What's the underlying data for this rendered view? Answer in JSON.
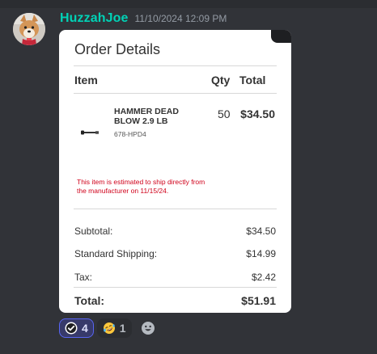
{
  "message": {
    "username": "HuzzahJoe",
    "timestamp": "11/10/2024 12:09 PM",
    "username_color": "#00d2b6"
  },
  "order": {
    "title": "Order Details",
    "headers": {
      "item": "Item",
      "qty": "Qty",
      "total": "Total"
    },
    "item": {
      "name": "HAMMER DEAD BLOW 2.9 LB",
      "sku": "678-HPD4",
      "qty": "50",
      "price": "$34.50"
    },
    "shipping_note": "This item is estimated to ship directly from the manufacturer on 11/15/24.",
    "summary": [
      {
        "label": "Subtotal:",
        "value": "$34.50"
      },
      {
        "label": "Standard Shipping:",
        "value": "$14.99"
      },
      {
        "label": "Tax:",
        "value": "$2.42"
      },
      {
        "label": "Total:",
        "value": "$51.91"
      }
    ]
  },
  "reactions": [
    {
      "emoji": "check-badge-icon",
      "count": "4",
      "active": true
    },
    {
      "emoji": "rofl-emoji-icon",
      "count": "1",
      "active": false
    }
  ],
  "colors": {
    "background": "#313338",
    "accent": "#5865f2",
    "note_red": "#d0021b"
  }
}
